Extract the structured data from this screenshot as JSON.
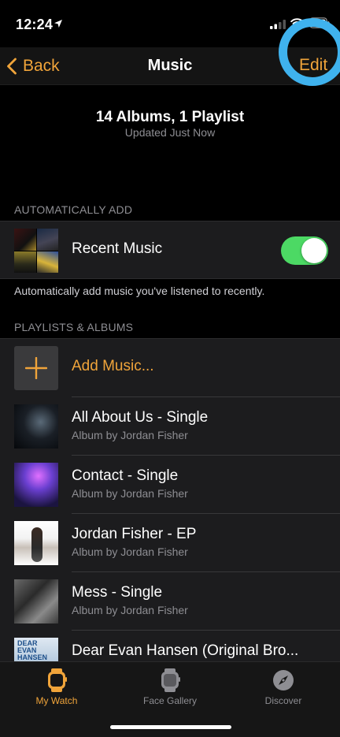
{
  "status_bar": {
    "time": "12:24"
  },
  "nav": {
    "back_label": "Back",
    "title": "Music",
    "edit_label": "Edit"
  },
  "summary": {
    "title": "14 Albums, 1 Playlist",
    "subtitle": "Updated Just Now"
  },
  "auto_add": {
    "header": "AUTOMATICALLY ADD",
    "label": "Recent Music",
    "toggle_on": true,
    "footer": "Automatically add music you've listened to recently."
  },
  "playlists": {
    "header": "PLAYLISTS & ALBUMS",
    "add_label": "Add Music...",
    "items": [
      {
        "title": "All About Us - Single",
        "subtitle": "Album by Jordan Fisher"
      },
      {
        "title": "Contact - Single",
        "subtitle": "Album by Jordan Fisher"
      },
      {
        "title": "Jordan Fisher - EP",
        "subtitle": "Album by Jordan Fisher"
      },
      {
        "title": "Mess - Single",
        "subtitle": "Album by Jordan Fisher"
      },
      {
        "title": "Dear Evan Hansen (Original Bro...",
        "subtitle": "",
        "art_text": "DEAR EVAN HANSEN"
      }
    ]
  },
  "tab_bar": {
    "tabs": [
      {
        "label": "My Watch",
        "icon": "watch-icon",
        "active": true
      },
      {
        "label": "Face Gallery",
        "icon": "watch-face-icon",
        "active": false
      },
      {
        "label": "Discover",
        "icon": "compass-icon",
        "active": false
      }
    ]
  },
  "colors": {
    "accent": "#f0a43a",
    "toggle_on": "#4cd964",
    "highlight_ring": "#3fb2ee"
  }
}
